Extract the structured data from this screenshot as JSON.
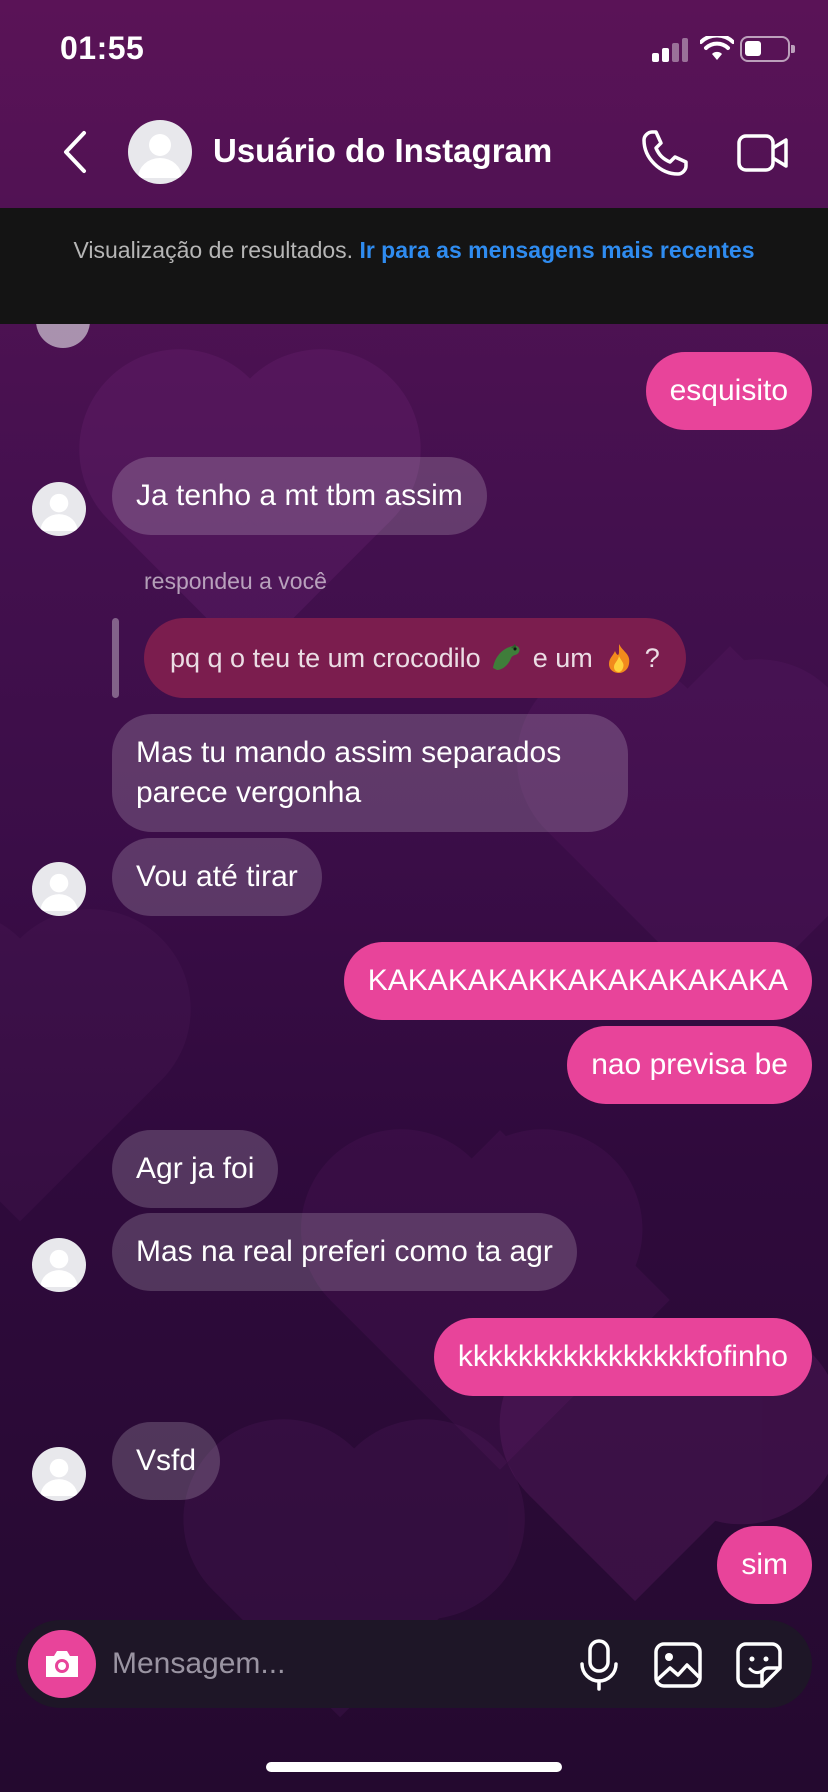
{
  "status_bar": {
    "time": "01:55",
    "signal_icon": "signal-bars-icon",
    "wifi_icon": "wifi-icon",
    "battery_icon": "battery-icon"
  },
  "header": {
    "contact_name": "Usuário do Instagram",
    "back_icon": "chevron-left-icon",
    "call_icon": "phone-icon",
    "video_icon": "video-camera-icon"
  },
  "results_banner": {
    "text": "Visualização de resultados.",
    "link": "Ir para as mensagens mais recentes"
  },
  "messages": [
    {
      "side": "out",
      "text": "esquisito"
    },
    {
      "side": "in",
      "text": "Ja tenho a mt tbm assim"
    },
    {
      "side": "in",
      "reply_label": "respondeu a você",
      "quoted_text_1": "pq q o teu te um crocodilo",
      "quoted_text_2": "e um",
      "quoted_text_3": "?",
      "quoted_emojis": [
        "crocodile-icon",
        "fire-icon"
      ]
    },
    {
      "side": "in",
      "text": "Mas tu mando assim separados parece vergonha"
    },
    {
      "side": "in",
      "text": "Vou até tirar"
    },
    {
      "side": "out",
      "text": "KAKAKAKAKKAKAKAKAKAKA"
    },
    {
      "side": "out",
      "text": "nao previsa be"
    },
    {
      "side": "in",
      "text": "Agr ja foi"
    },
    {
      "side": "in",
      "text": "Mas na real preferi como ta agr"
    },
    {
      "side": "out",
      "text": "kkkkkkkkkkkkkkkkfofinho"
    },
    {
      "side": "in",
      "text": "Vsfd"
    },
    {
      "side": "out",
      "text": "sim"
    }
  ],
  "composer": {
    "placeholder": "Mensagem...",
    "camera_icon": "camera-icon",
    "mic_icon": "microphone-icon",
    "gallery_icon": "image-icon",
    "sticker_icon": "sticker-icon"
  },
  "colors": {
    "outgoing_bubble": "#e8449a",
    "link": "#2f8cf0",
    "banner_bg": "#141414",
    "header_bg": "#5a1357"
  }
}
